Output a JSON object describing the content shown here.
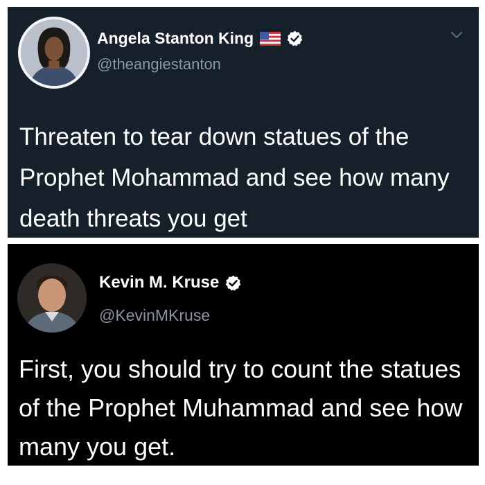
{
  "tweets": [
    {
      "author": "Angela Stanton King",
      "handle": "@theangiestanton",
      "text": "Threaten to tear down statues of the Prophet Mohammad and see how many death threats you get",
      "icons": [
        "avatar",
        "us-flag-icon",
        "verified-icon",
        "chevron-down-icon"
      ]
    },
    {
      "author": "Kevin M. Kruse",
      "handle": "@KevinMKruse",
      "text": "First, you should try to count the statues of the Prophet Muhammad and see how many you get.",
      "icons": [
        "avatar",
        "verified-icon"
      ]
    }
  ],
  "colors": {
    "dim_background": "#15202b",
    "black_background": "#000000",
    "text": "#ffffff",
    "secondary_text": "#8899a6"
  }
}
